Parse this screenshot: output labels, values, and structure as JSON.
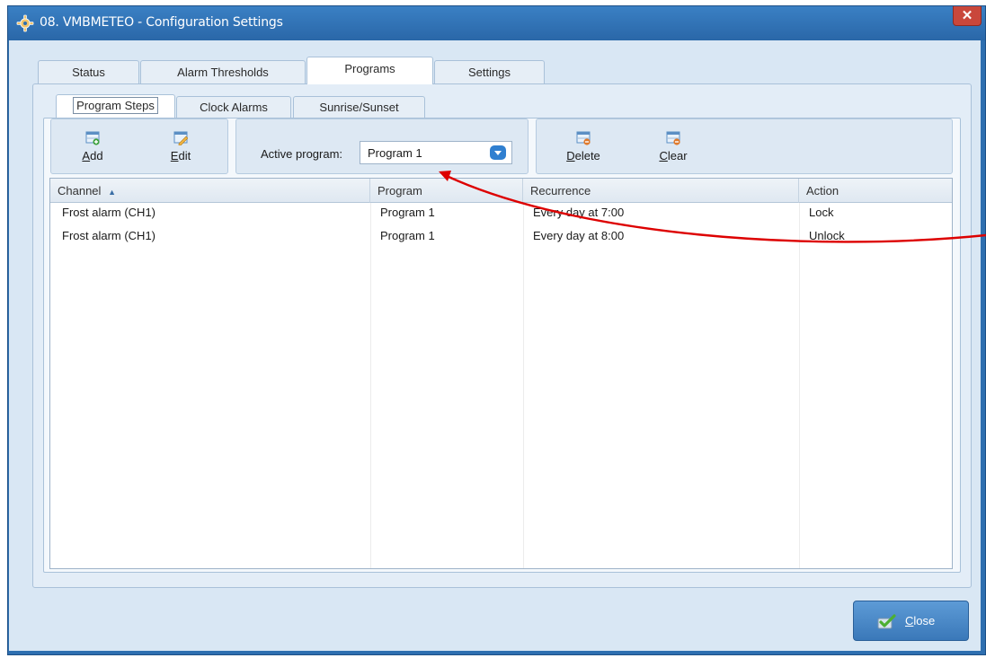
{
  "window": {
    "title": "08. VMBMETEO - Configuration Settings",
    "close_glyph": "✕"
  },
  "tabs": [
    {
      "label": "Status"
    },
    {
      "label": "Alarm Thresholds"
    },
    {
      "label": "Programs"
    },
    {
      "label": "Settings"
    }
  ],
  "subtabs": [
    {
      "label": "Program Steps"
    },
    {
      "label": "Clock Alarms"
    },
    {
      "label": "Sunrise/Sunset"
    }
  ],
  "toolbar": {
    "add": {
      "mnemonic": "A",
      "rest": "dd"
    },
    "edit": {
      "mnemonic": "E",
      "rest": "dit"
    },
    "active_program_label": "Active program:",
    "active_program_value": "Program 1",
    "delete": {
      "mnemonic": "D",
      "rest": "elete"
    },
    "clear": {
      "mnemonic": "C",
      "rest": "lear"
    }
  },
  "grid": {
    "columns": [
      "Channel",
      "Program",
      "Recurrence",
      "Action"
    ],
    "sort_indicator": "▲",
    "rows": [
      {
        "channel": "Frost alarm (CH1)",
        "program": "Program 1",
        "recurrence": "Every day at 7:00",
        "action": "Lock"
      },
      {
        "channel": "Frost alarm (CH1)",
        "program": "Program 1",
        "recurrence": "Every day at 8:00",
        "action": "Unlock"
      }
    ]
  },
  "footer": {
    "close": {
      "mnemonic": "C",
      "rest": "lose"
    }
  },
  "colors": {
    "title_bar": "#2e6fb0",
    "annotation_arrow": "#dd0000",
    "accent": "#2f7fd0"
  }
}
